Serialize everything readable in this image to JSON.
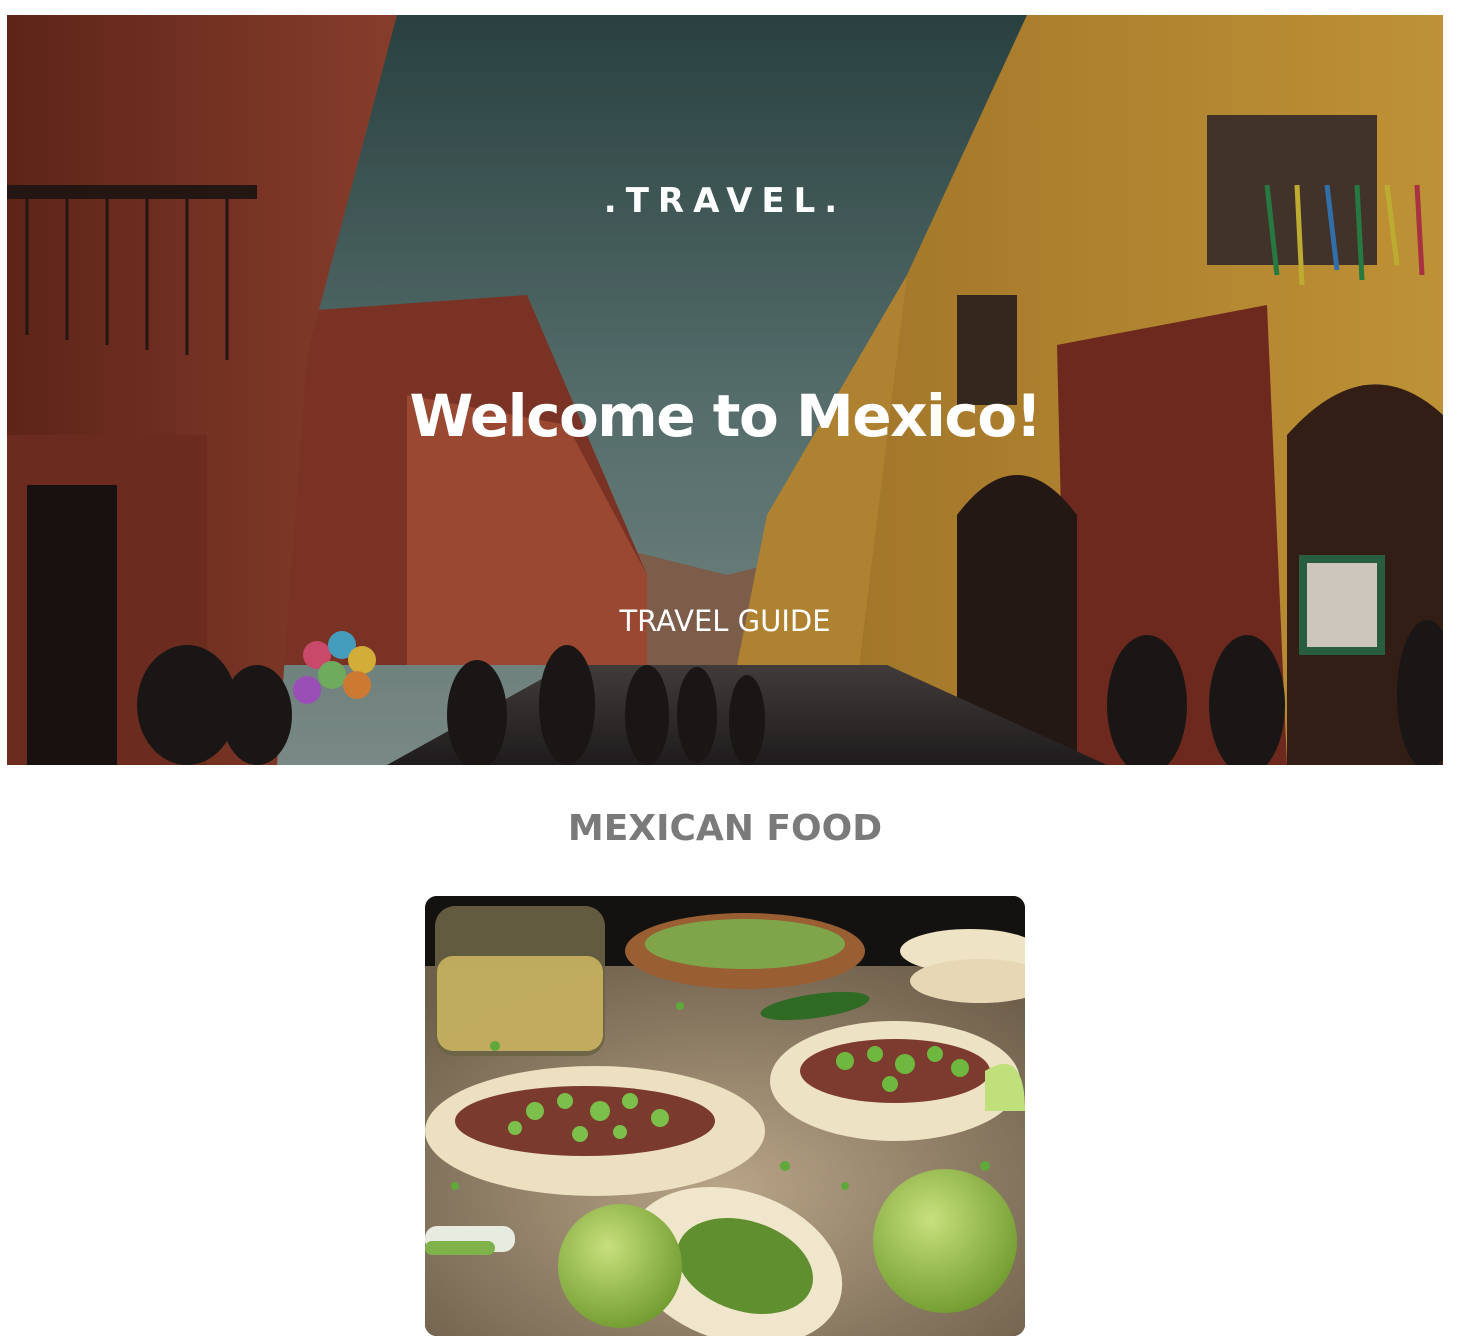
{
  "hero": {
    "brand": ".TRAVEL.",
    "title": "Welcome to Mexico!",
    "subtitle": "TRAVEL GUIDE",
    "image_subject": "colorful colonial street in Mexico with people walking"
  },
  "food_section": {
    "title": "MEXICAN FOOD",
    "image_subject": "street tacos with lime and cilantro"
  },
  "colors": {
    "section_title": "#7a7a7a",
    "hero_text": "#ffffff",
    "page_background": "#ffffff"
  }
}
